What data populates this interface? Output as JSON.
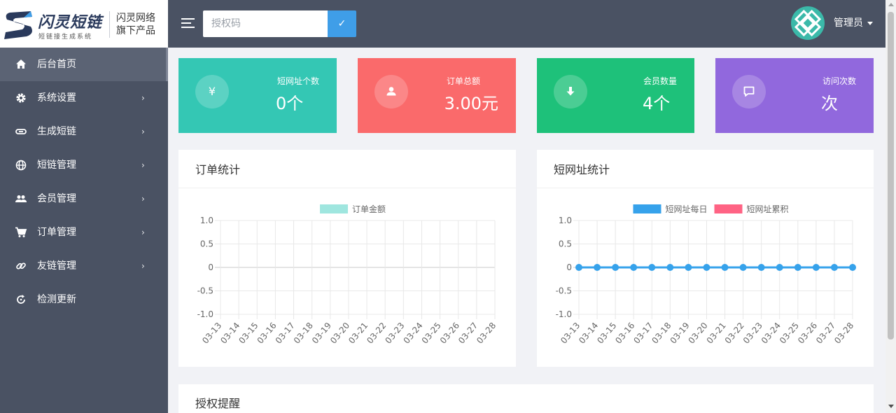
{
  "brand": {
    "title": "闪灵短链",
    "subtitle": "短链接生成系统",
    "right_line1": "闪灵网络",
    "right_line2": "旗下产品"
  },
  "sidebar": {
    "items": [
      {
        "label": "后台首页",
        "icon": "home-icon",
        "arrow": false,
        "active": true
      },
      {
        "label": "系统设置",
        "icon": "gear-icon",
        "arrow": true
      },
      {
        "label": "生成短链",
        "icon": "link-icon",
        "arrow": true
      },
      {
        "label": "短链管理",
        "icon": "globe-icon",
        "arrow": true
      },
      {
        "label": "会员管理",
        "icon": "users-icon",
        "arrow": true
      },
      {
        "label": "订单管理",
        "icon": "cart-icon",
        "arrow": true
      },
      {
        "label": "友链管理",
        "icon": "chain-icon",
        "arrow": true
      },
      {
        "label": "检测更新",
        "icon": "refresh-icon",
        "arrow": false
      }
    ],
    "arrow_glyph": "›"
  },
  "topbar": {
    "auth_placeholder": "授权码",
    "auth_button": "✓",
    "admin_name": "管理员"
  },
  "stats": [
    {
      "label": "短网址个数",
      "value": "0个",
      "icon": "yen-icon",
      "glyph": "¥",
      "color": "#34c7b4"
    },
    {
      "label": "订单总额",
      "value": "3.00元",
      "icon": "user-icon",
      "glyph": "",
      "color": "#fa6a6b"
    },
    {
      "label": "会员数量",
      "value": "4个",
      "icon": "download-icon",
      "glyph": "",
      "color": "#1ec17a"
    },
    {
      "label": "访问次数",
      "value": "次",
      "icon": "comment-icon",
      "glyph": "",
      "color": "#9168dd"
    }
  ],
  "panels": {
    "order_title": "订单统计",
    "url_title": "短网址统计",
    "auth_title": "授权提醒"
  },
  "chart_data": [
    {
      "type": "line",
      "categories": [
        "03-13",
        "03-14",
        "03-15",
        "03-16",
        "03-17",
        "03-18",
        "03-19",
        "03-20",
        "03-21",
        "03-22",
        "03-23",
        "03-24",
        "03-25",
        "03-26",
        "03-27",
        "03-28"
      ],
      "series": [
        {
          "name": "订单金额",
          "values": [],
          "color": "#9fe6df"
        }
      ],
      "yticks": [
        "1.0",
        "0.5",
        "0",
        "-0.5",
        "-1.0"
      ],
      "ylim": [
        -1,
        1
      ],
      "grid": true,
      "legend": "top"
    },
    {
      "type": "line",
      "categories": [
        "03-13",
        "03-14",
        "03-15",
        "03-16",
        "03-17",
        "03-18",
        "03-19",
        "03-20",
        "03-21",
        "03-22",
        "03-23",
        "03-24",
        "03-25",
        "03-26",
        "03-27",
        "03-28"
      ],
      "series": [
        {
          "name": "短网址每日",
          "values": [
            0,
            0,
            0,
            0,
            0,
            0,
            0,
            0,
            0,
            0,
            0,
            0,
            0,
            0,
            0,
            0
          ],
          "color": "#36a2eb"
        },
        {
          "name": "短网址累积",
          "values": [],
          "color": "#ff6384"
        }
      ],
      "yticks": [
        "1.0",
        "0.5",
        "0",
        "-0.5",
        "-1.0"
      ],
      "ylim": [
        -1,
        1
      ],
      "grid": true,
      "legend": "top"
    }
  ]
}
